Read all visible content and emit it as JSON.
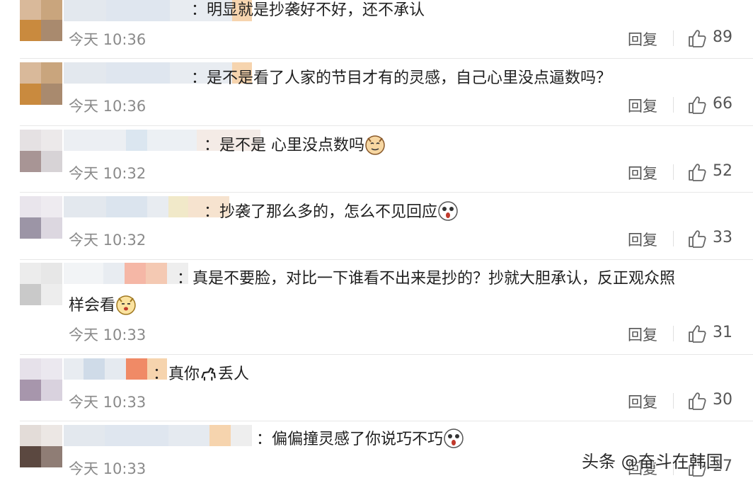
{
  "colors": {
    "time": "#8a8a8a",
    "action": "#555555",
    "divider": "#e7e7e7"
  },
  "icons": {
    "like": "thumbs-up-icon",
    "emoji": "emoji-icon"
  },
  "comments": [
    {
      "text": "：明显就是抄袭好不好，还不承认",
      "time": "今天 10:36",
      "reply": "回复",
      "likes": "89"
    },
    {
      "text": "：是不是看了人家的节目才有的灵感，自己心里没点逼数吗？",
      "time": "今天 10:36",
      "reply": "回复",
      "likes": "66"
    },
    {
      "text": "：是不是 心里没点数吗",
      "time": "今天 10:32",
      "reply": "回复",
      "likes": "52"
    },
    {
      "text": "：抄袭了那么多的，怎么不见回应",
      "time": "今天 10:32",
      "reply": "回复",
      "likes": "33"
    },
    {
      "text": "：真是不要脸，对比一下谁看不出来是抄的？抄就大胆承认，反正观众照",
      "text2": "样会看",
      "time": "今天 10:33",
      "reply": "回复",
      "likes": "31"
    },
    {
      "text": "：真你",
      "text_after": "丢人",
      "time": "今天 10:33",
      "reply": "回复",
      "likes": "30"
    },
    {
      "text": "：偏偏撞灵感了你说巧不巧",
      "time": "今天 10:33",
      "reply": "回复",
      "likes": "27"
    }
  ],
  "watermark": "头条 @奋斗在韩国"
}
